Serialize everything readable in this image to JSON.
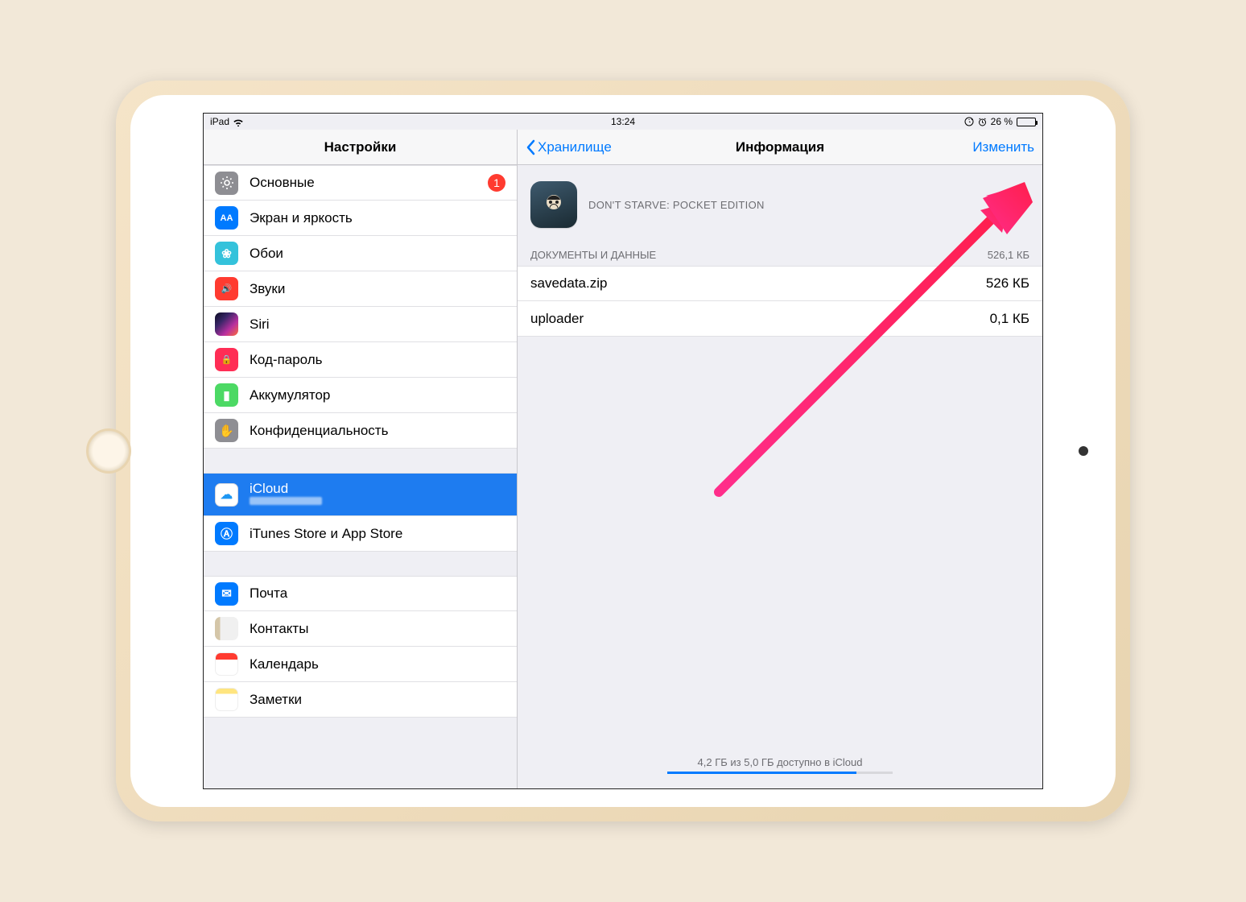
{
  "status": {
    "device": "iPad",
    "time": "13:24",
    "battery_pct": "26 %"
  },
  "sidebar": {
    "title": "Настройки",
    "groups": [
      {
        "items": [
          {
            "label": "Основные",
            "icon": "gear-icon",
            "badge": "1",
            "ic": "ic-gray"
          },
          {
            "label": "Экран и яркость",
            "icon": "brightness-icon",
            "ic": "ic-blue",
            "glyph": "AA"
          },
          {
            "label": "Обои",
            "icon": "wallpaper-icon",
            "ic": "ic-teal",
            "glyph": "❀"
          },
          {
            "label": "Звуки",
            "icon": "sounds-icon",
            "ic": "ic-red",
            "glyph": "🔊"
          },
          {
            "label": "Siri",
            "icon": "siri-icon",
            "ic": "ic-siri"
          },
          {
            "label": "Код-пароль",
            "icon": "passcode-icon",
            "ic": "ic-pink",
            "glyph": "🔒"
          },
          {
            "label": "Аккумулятор",
            "icon": "battery-icon",
            "ic": "ic-green",
            "glyph": "▮"
          },
          {
            "label": "Конфиденциальность",
            "icon": "privacy-icon",
            "ic": "ic-gray",
            "glyph": "✋"
          }
        ]
      },
      {
        "items": [
          {
            "label": "iCloud",
            "icon": "cloud-icon",
            "ic": "ic-white",
            "glyph": "☁",
            "selected": true,
            "tall": true
          },
          {
            "label": "iTunes Store и App Store",
            "icon": "appstore-icon",
            "ic": "ic-blue",
            "glyph": "Ⓐ"
          }
        ]
      },
      {
        "items": [
          {
            "label": "Почта",
            "icon": "mail-icon",
            "ic": "ic-blue",
            "glyph": "✉"
          },
          {
            "label": "Контакты",
            "icon": "contacts-icon",
            "ic": "ic-contacts"
          },
          {
            "label": "Календарь",
            "icon": "calendar-icon",
            "ic": "ic-cal"
          },
          {
            "label": "Заметки",
            "icon": "notes-icon",
            "ic": "ic-notes"
          }
        ]
      }
    ]
  },
  "detail": {
    "back_label": "Хранилище",
    "title": "Информация",
    "edit_label": "Изменить",
    "app_name": "DON'T STARVE: POCKET EDITION",
    "section_header": "ДОКУМЕНТЫ И ДАННЫЕ",
    "section_total": "526,1 КБ",
    "rows": [
      {
        "name": "savedata.zip",
        "size": "526 КБ"
      },
      {
        "name": "uploader",
        "size": "0,1 КБ"
      }
    ],
    "footer": "4,2 ГБ из 5,0 ГБ доступно в iCloud",
    "storage_fill_pct": 84
  }
}
